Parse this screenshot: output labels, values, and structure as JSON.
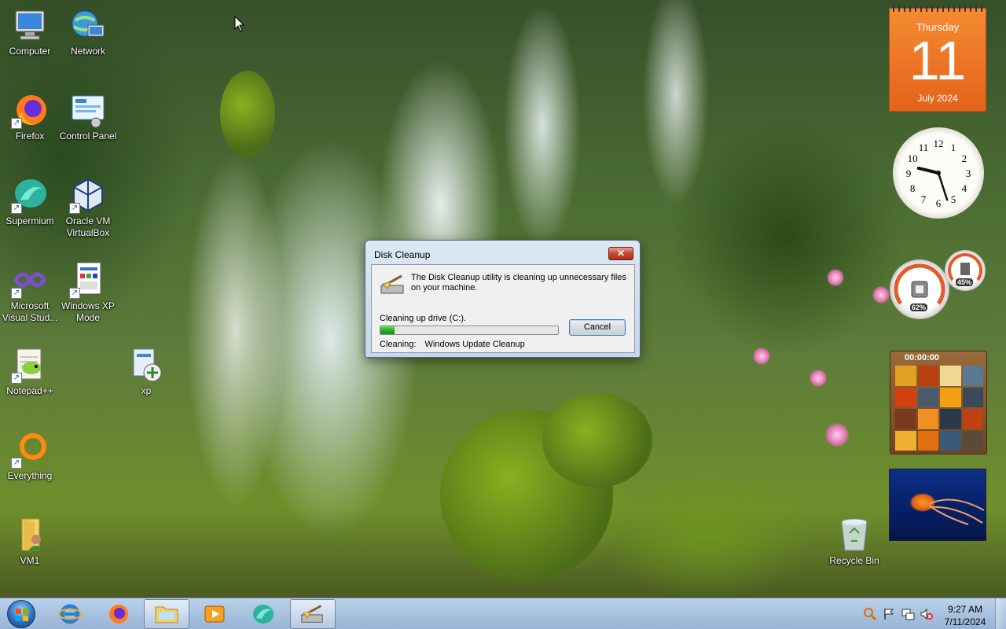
{
  "desktop": {
    "icons": [
      {
        "label": "Computer",
        "icon": "computer-icon"
      },
      {
        "label": "Network",
        "icon": "network-icon"
      },
      {
        "label": "Firefox",
        "icon": "firefox-icon"
      },
      {
        "label": "Control Panel",
        "icon": "control-panel-icon"
      },
      {
        "label": "Supermium",
        "icon": "supermium-icon"
      },
      {
        "label": "Oracle VM VirtualBox",
        "icon": "virtualbox-icon"
      },
      {
        "label": "Microsoft Visual Stud...",
        "icon": "visual-studio-icon"
      },
      {
        "label": "Windows XP Mode",
        "icon": "xp-mode-icon"
      },
      {
        "label": "Notepad++",
        "icon": "notepadpp-icon"
      },
      {
        "label": "xp",
        "icon": "xp-installer-icon"
      },
      {
        "label": "Everything",
        "icon": "everything-icon"
      },
      {
        "label": "VM1",
        "icon": "folder-user-icon"
      },
      {
        "label": "Recycle Bin",
        "icon": "recycle-bin-icon"
      }
    ]
  },
  "gadgets": {
    "calendar": {
      "weekday": "Thursday",
      "day": "11",
      "month_year": "July 2024"
    },
    "clock": {
      "numerals": [
        "12",
        "1",
        "2",
        "3",
        "4",
        "5",
        "6",
        "7",
        "8",
        "9",
        "10",
        "11"
      ],
      "hour": 9,
      "minute": 27
    },
    "meters": {
      "cpu": "62%",
      "memory": "45%"
    },
    "puzzle": {
      "timer": "00:00:00"
    }
  },
  "dialog": {
    "title": "Disk Cleanup",
    "close_label": "✕",
    "message": "The Disk Cleanup utility is cleaning up unnecessary files on your machine.",
    "drive_label": "Cleaning up drive  (C:).",
    "progress_fraction": 0.08,
    "cancel_label": "Cancel",
    "cleaning_label": "Cleaning:",
    "cleaning_item": "Windows Update Cleanup"
  },
  "taskbar": {
    "pinned": [
      {
        "name": "internet-explorer",
        "icon": "ie-icon"
      },
      {
        "name": "firefox",
        "icon": "firefox-icon"
      },
      {
        "name": "explorer",
        "icon": "folder-icon"
      },
      {
        "name": "media-player",
        "icon": "media-player-icon"
      },
      {
        "name": "supermium",
        "icon": "supermium-icon"
      },
      {
        "name": "disk-cleanup",
        "icon": "disk-cleanup-icon"
      }
    ],
    "time": "9:27 AM",
    "date": "7/11/2024"
  }
}
